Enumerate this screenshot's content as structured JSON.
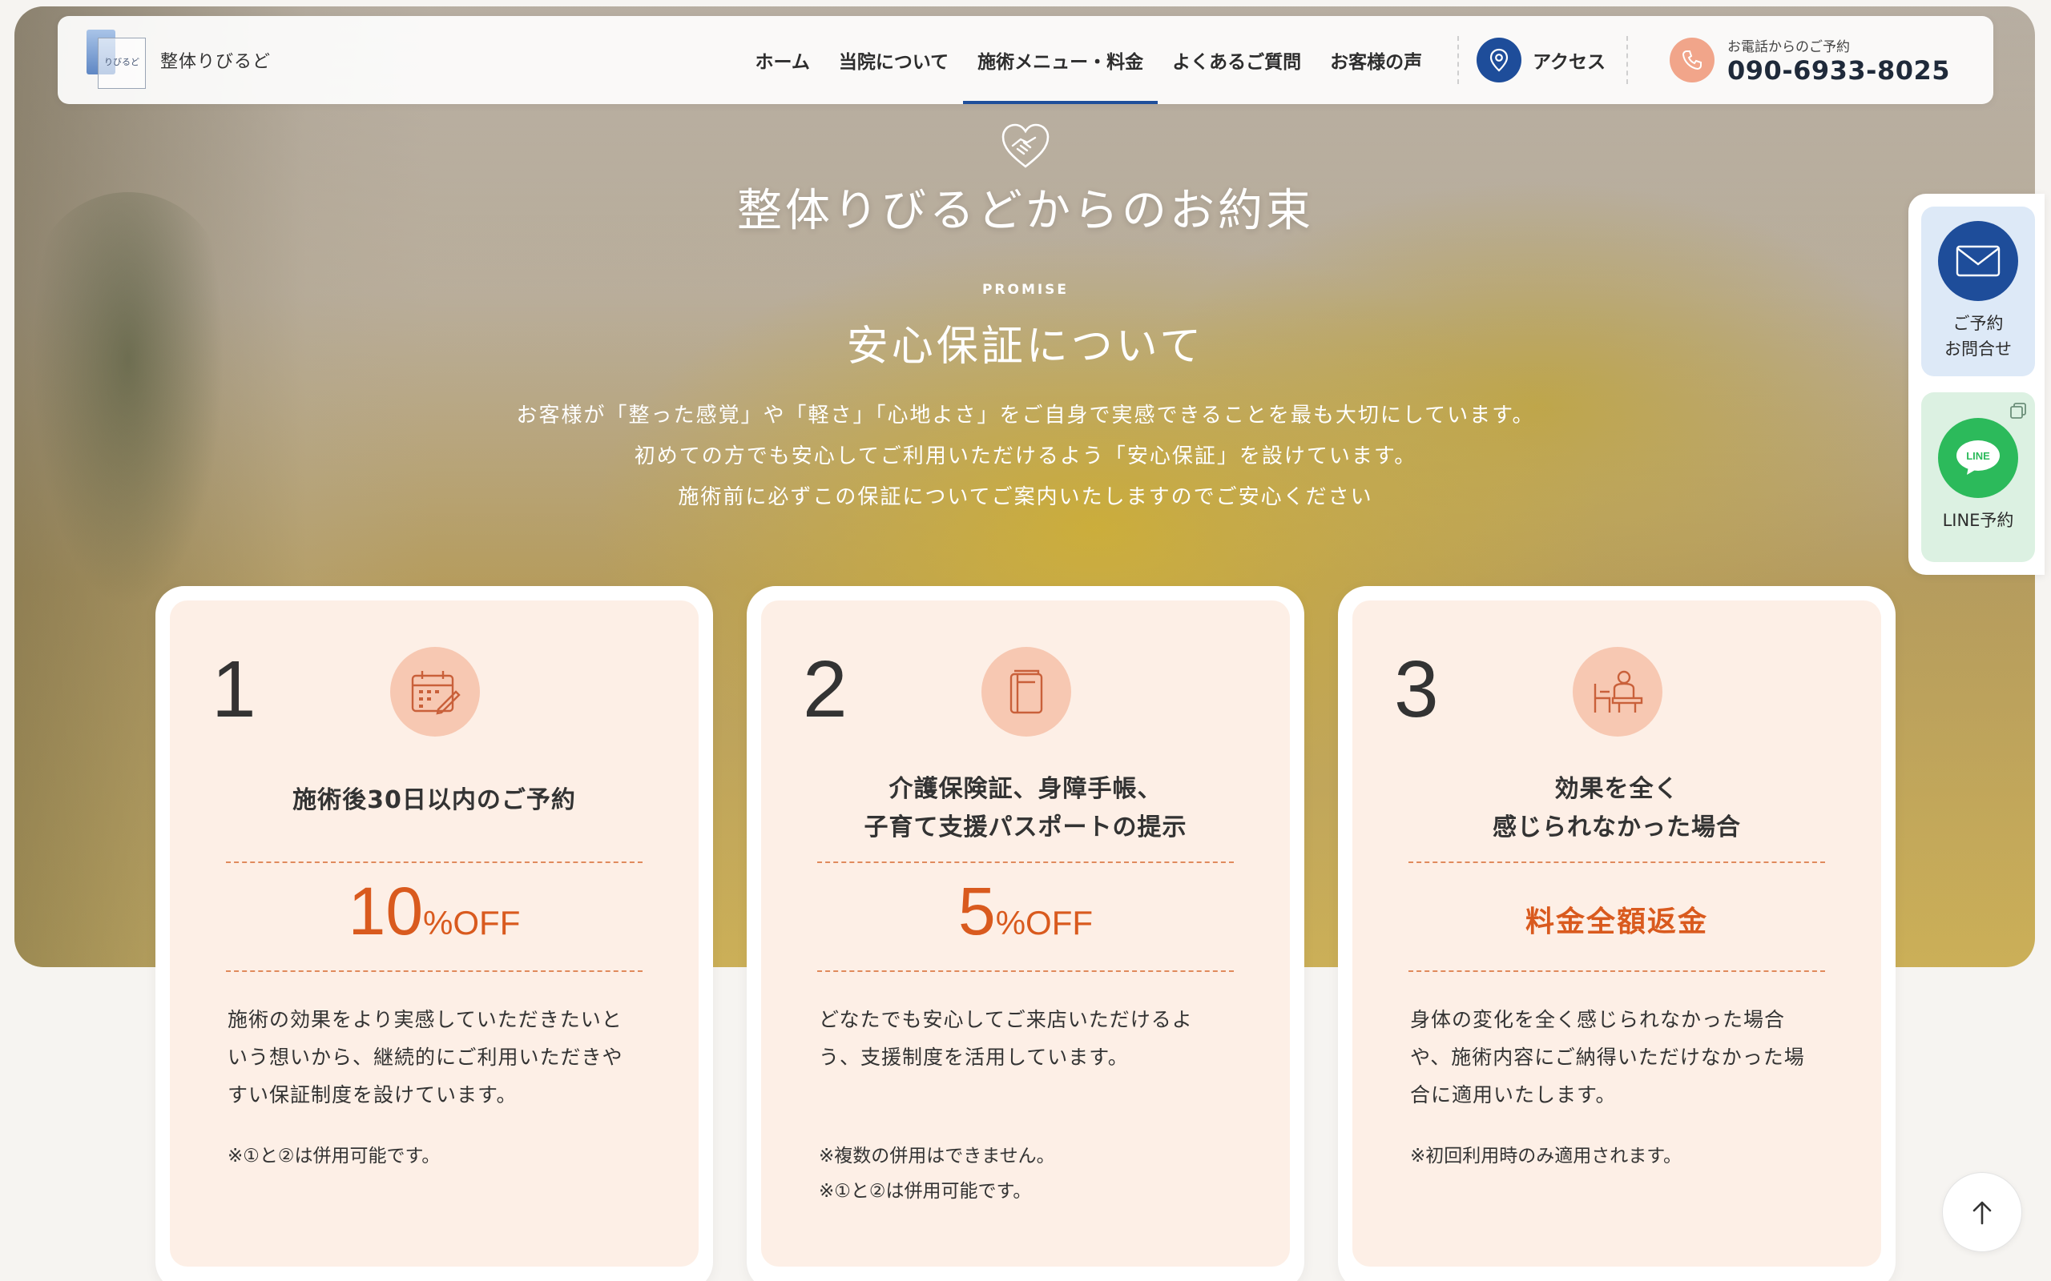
{
  "header": {
    "logo_mark_text": "りびるど",
    "logo_name": "整体りびるど",
    "nav": [
      {
        "label": "ホーム"
      },
      {
        "label": "当院について"
      },
      {
        "label": "施術メニュー・料金"
      },
      {
        "label": "よくあるご質問"
      },
      {
        "label": "お客様の声"
      }
    ],
    "active_nav": "施術メニュー・料金",
    "access_label": "アクセス",
    "tel_caption": "お電話からのご予約",
    "tel_number": "090-6933-8025"
  },
  "hero": {
    "title": "整体りびるどからのお約束",
    "promise_en": "PROMISE",
    "promise_ja": "安心保証について",
    "intro_lines": [
      "お客様が「整った感覚」や「軽さ」「心地よさ」をご自身で実感できることを最も大切にしています。",
      "初めての方でも安心してご利用いただけるよう「安心保証」を設けています。",
      "施術前に必ずこの保証についてご案内いたしますのでご安心ください"
    ]
  },
  "cards": [
    {
      "number": "1",
      "icon": "calendar-icon",
      "title_lines": [
        "施術後30日以内のご予約"
      ],
      "discount_value": "10",
      "discount_unit": "%OFF",
      "desc_lines": [
        "施術の効果をより実感していただきたいと",
        "いう想いから、継続的にご利用いただきや",
        "すい保証制度を設けています。"
      ],
      "notes": [
        "※①と②は併用可能です。"
      ]
    },
    {
      "number": "2",
      "icon": "notebook-icon",
      "title_lines": [
        "介護保険証、身障手帳、",
        "子育て支援パスポートの提示"
      ],
      "discount_value": "5",
      "discount_unit": "%OFF",
      "desc_lines": [
        "どなたでも安心してご来店いただけるよ",
        "う、支援制度を活用しています。"
      ],
      "notes": [
        "※複数の併用はできません。",
        "※①と②は併用可能です。"
      ]
    },
    {
      "number": "3",
      "icon": "consultation-icon",
      "title_lines": [
        "効果を全く",
        "感じられなかった場合"
      ],
      "refund": "料金全額返金",
      "desc_lines": [
        "身体の変化を全く感じられなかった場合",
        "や、施術内容にご納得いただけなかった場",
        "合に適用いたします。"
      ],
      "notes": [
        "※初回利用時のみ適用されます。"
      ]
    }
  ],
  "side": {
    "contact_line1": "ご予約",
    "contact_line2": "お問合せ",
    "line_badge": "LINE",
    "line_label": "LINE予約"
  },
  "colors": {
    "brand_blue": "#1e4d9a",
    "accent_orange": "#d95a1e",
    "card_bg": "#fdefe6",
    "line_green": "#2cba5b"
  }
}
